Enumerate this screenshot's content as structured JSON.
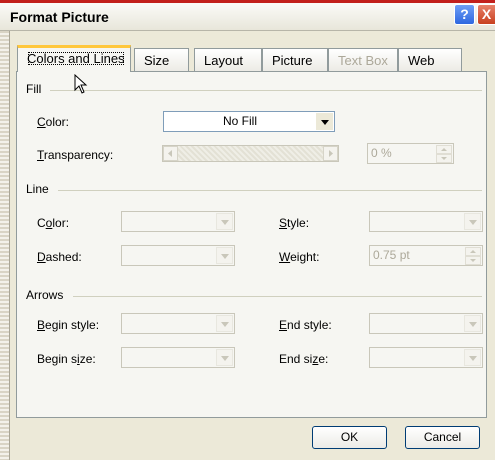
{
  "window": {
    "title": "Format Picture",
    "help_glyph": "?",
    "close_glyph": "X"
  },
  "tabs": [
    {
      "label": "Colors and Lines",
      "active": true,
      "enabled": true
    },
    {
      "label": "Size",
      "active": false,
      "enabled": true
    },
    {
      "label": "Layout",
      "active": false,
      "enabled": true
    },
    {
      "label": "Picture",
      "active": false,
      "enabled": true
    },
    {
      "label": "Text Box",
      "active": false,
      "enabled": false
    },
    {
      "label": "Web",
      "active": false,
      "enabled": true
    }
  ],
  "fill": {
    "section_label": "Fill",
    "color_label": "Color:",
    "color_value": "No Fill",
    "transparency_label": "Transparency:",
    "transparency_value": "0 %"
  },
  "line": {
    "section_label": "Line",
    "color_label": "Color:",
    "dashed_label": "Dashed:",
    "style_label": "Style:",
    "weight_label": "Weight:",
    "weight_value": "0.75 pt"
  },
  "arrows": {
    "section_label": "Arrows",
    "begin_style_label": "Begin style:",
    "begin_size_label": "Begin size:",
    "end_style_label": "End style:",
    "end_size_label": "End size:"
  },
  "buttons": {
    "ok": "OK",
    "cancel": "Cancel"
  },
  "colors": {
    "accent_tab": "#ffc73c",
    "title_strip": "#c2201c",
    "disabled_text": "#aca899"
  }
}
